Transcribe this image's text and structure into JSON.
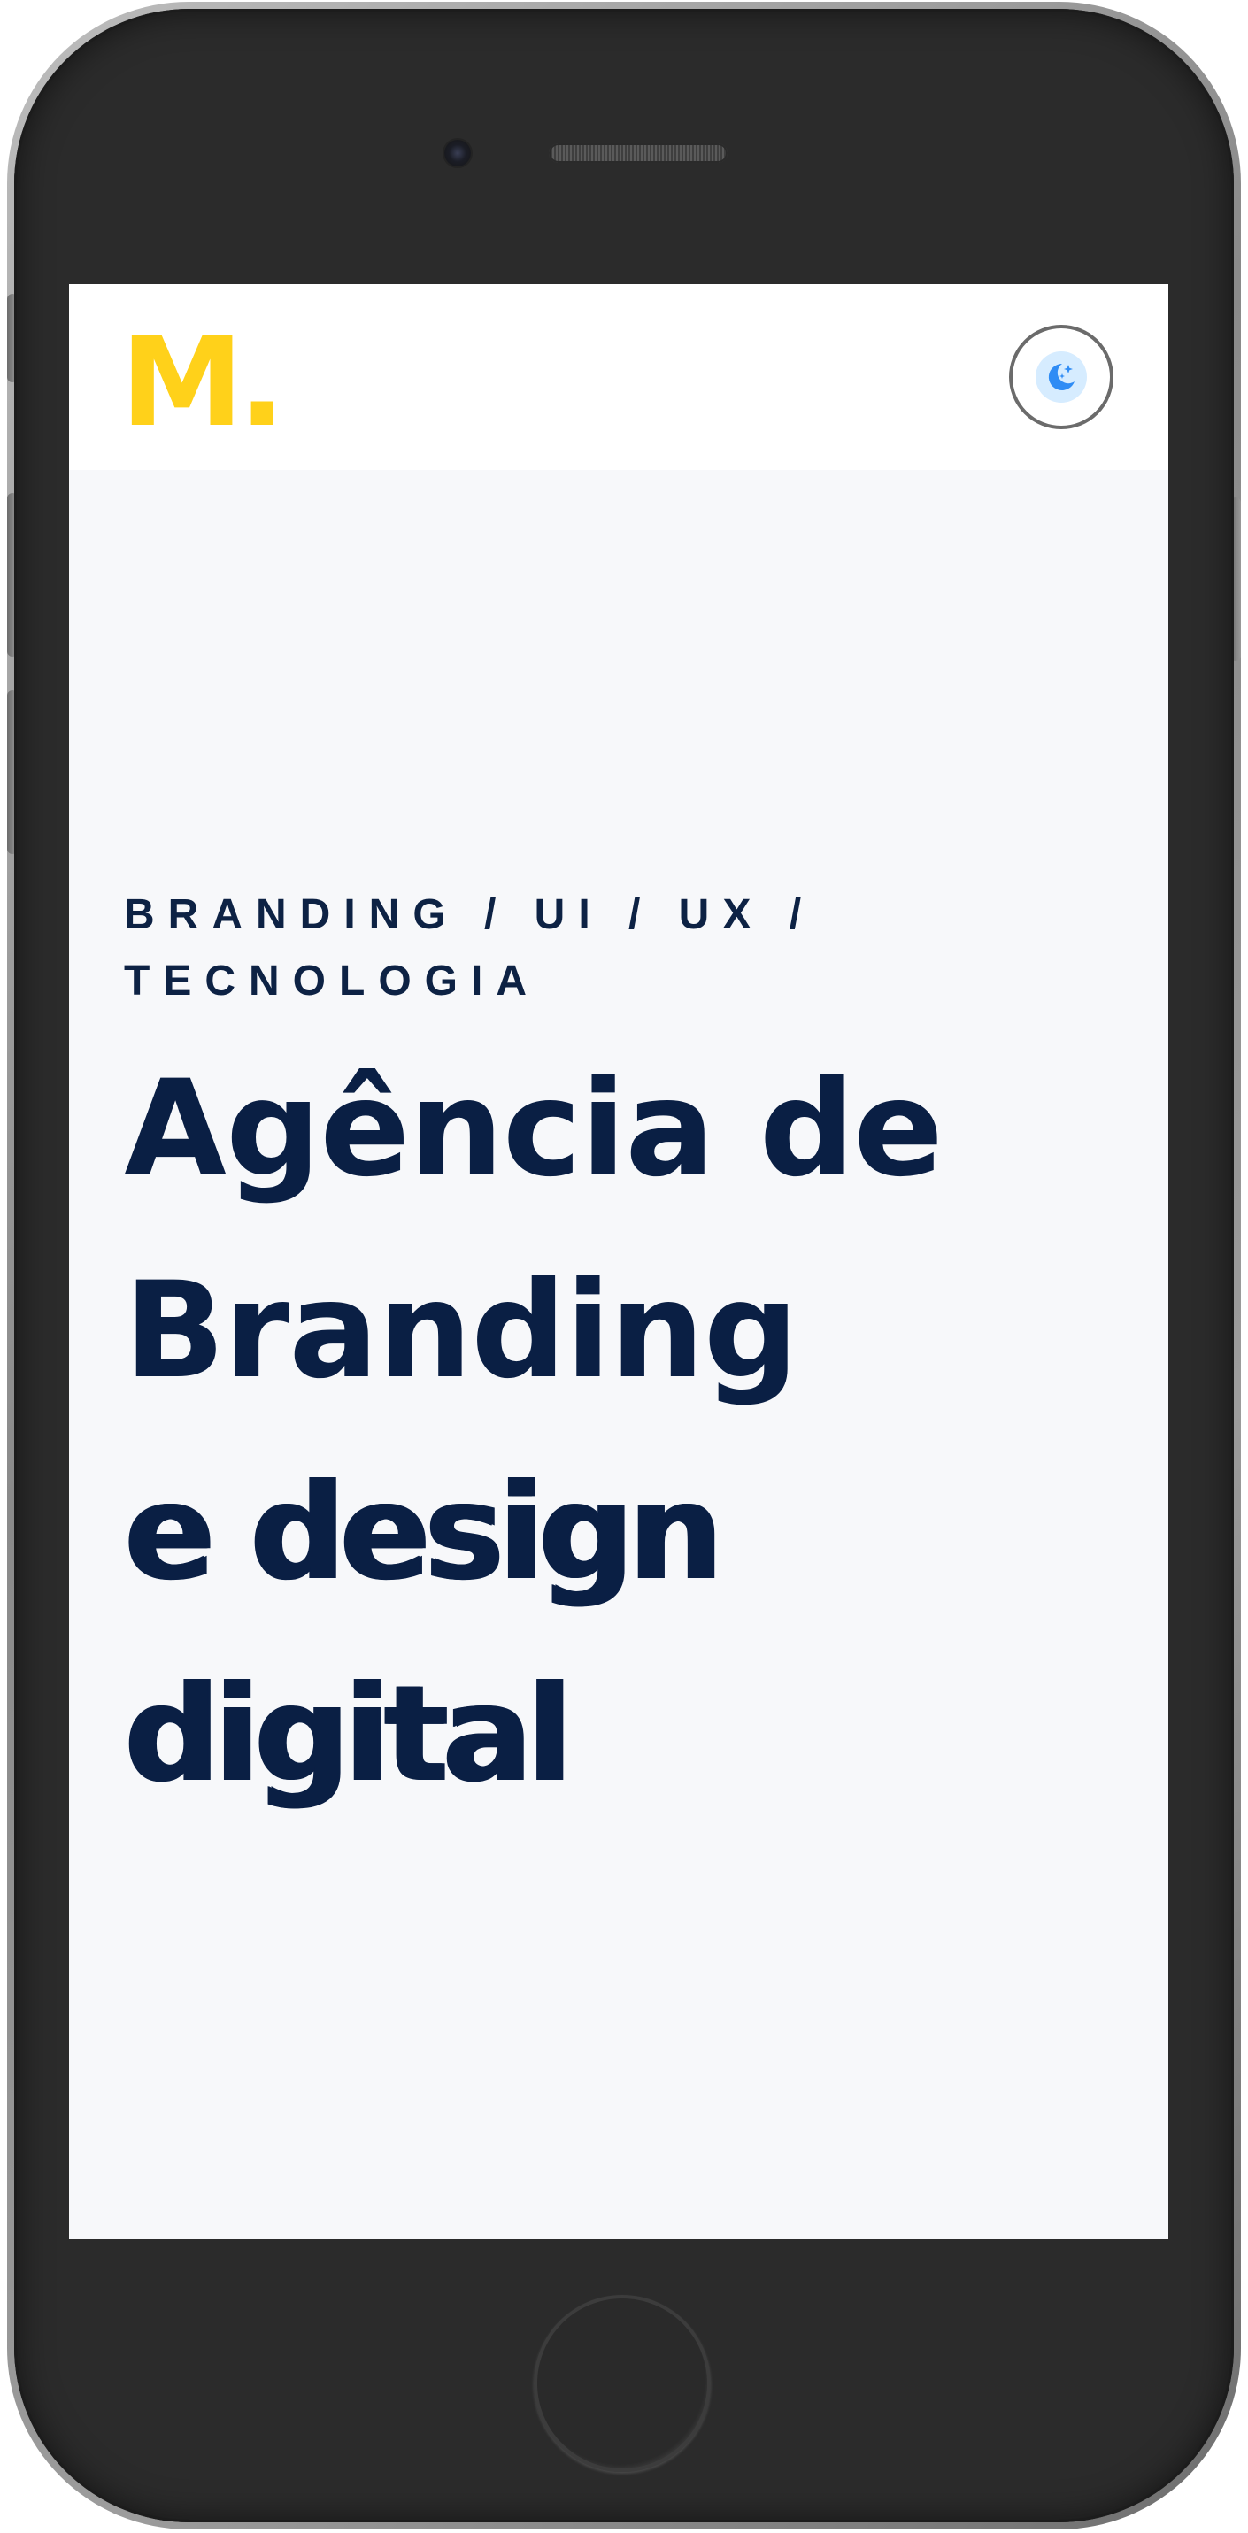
{
  "header": {
    "logo_text": "M",
    "logo_dot": ".",
    "theme_toggle_icon": "moon-stars-icon"
  },
  "hero": {
    "kicker": "BRANDING / UI / UX /\nTECNOLOGIA",
    "headline_lines": [
      "Agência de",
      "Branding",
      "e design",
      "digital"
    ]
  },
  "colors": {
    "logo": "#ffd11a",
    "text": "#0a1f44",
    "screen_background": "#f7f8fa",
    "header_background": "#ffffff",
    "toggle_accent": "#2f8cf5"
  }
}
